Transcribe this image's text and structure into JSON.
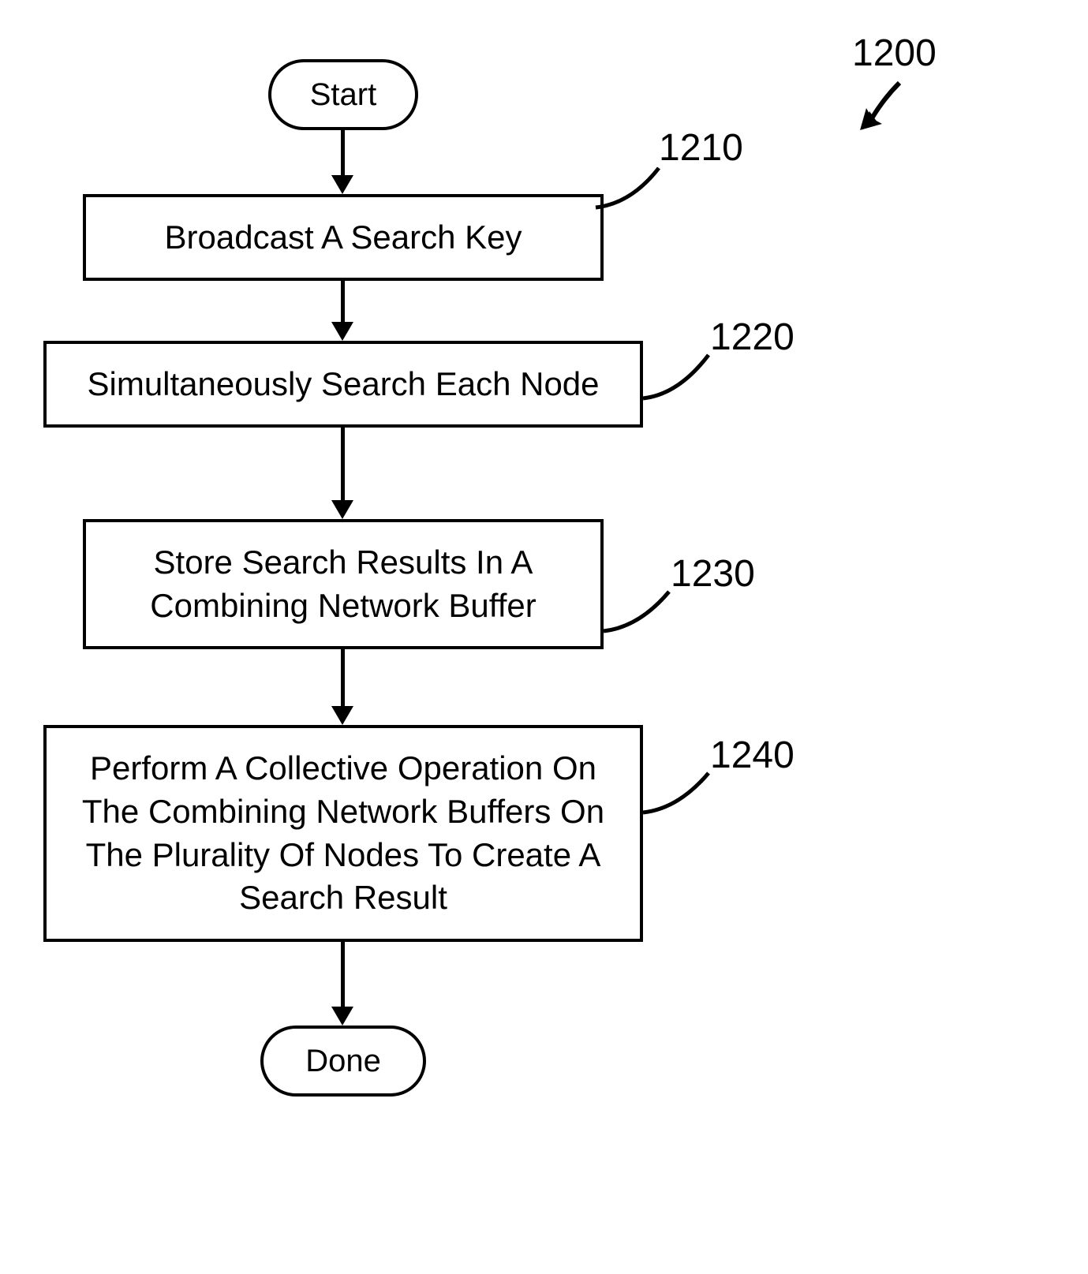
{
  "diagram": {
    "main_label": "1200",
    "start": "Start",
    "done": "Done",
    "steps": [
      {
        "label": "1210",
        "text": "Broadcast A Search Key"
      },
      {
        "label": "1220",
        "text": "Simultaneously Search Each Node"
      },
      {
        "label": "1230",
        "text": "Store Search Results In A Combining Network Buffer"
      },
      {
        "label": "1240",
        "text": "Perform A Collective Operation On The Combining Network Buffers On The Plurality Of Nodes To Create A Search Result"
      }
    ]
  }
}
